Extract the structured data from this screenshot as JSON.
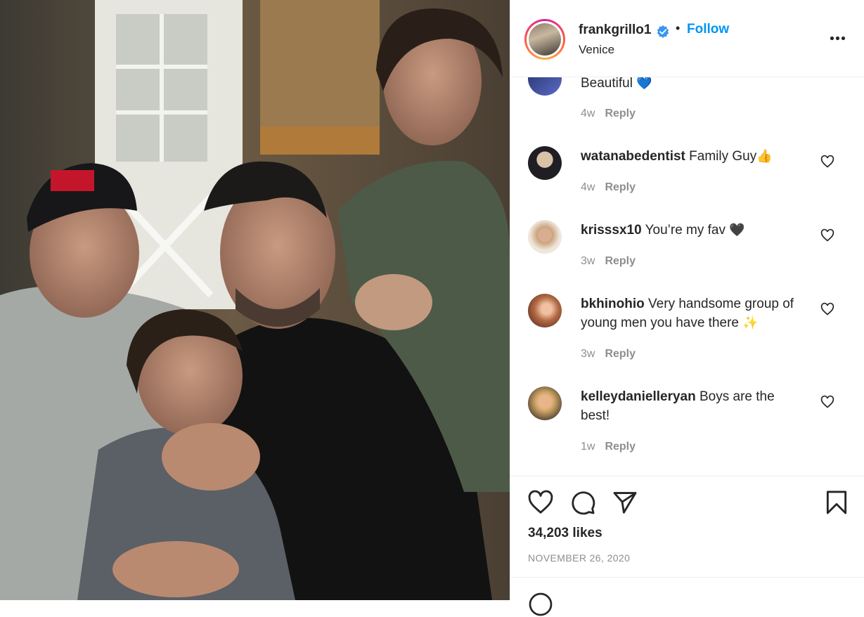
{
  "post": {
    "username": "frankgrillo1",
    "location": "Venice",
    "follow_label": "Follow",
    "separator": "•",
    "likes": "34,203 likes",
    "date": "November 26, 2020"
  },
  "first_comment": {
    "text": "Beautiful",
    "emoji": "💙",
    "time": "4w",
    "reply_label": "Reply"
  },
  "comments": [
    {
      "user": "watanabedentist",
      "text": "Family Guy",
      "emoji": "👍",
      "time": "4w",
      "reply_label": "Reply"
    },
    {
      "user": "krisssx10",
      "text": "You’re my fav",
      "emoji": "🖤",
      "time": "3w",
      "reply_label": "Reply"
    },
    {
      "user": "bkhinohio",
      "text": "Very handsome group of young men you have there",
      "emoji": "✨",
      "time": "3w",
      "reply_label": "Reply"
    },
    {
      "user": "kelleydanielleryan",
      "text": "Boys are the best!",
      "emoji": "",
      "time": "1w",
      "reply_label": "Reply"
    }
  ],
  "icons": {
    "verified": "verified-badge-icon",
    "more": "more-options-icon",
    "like": "heart-icon",
    "comment": "comment-icon",
    "share": "send-icon",
    "save": "bookmark-icon"
  },
  "colors": {
    "accent": "#0095f6",
    "text": "#262626",
    "muted": "#8e8e8e",
    "border": "#efefef",
    "verified": "#3897f0"
  }
}
